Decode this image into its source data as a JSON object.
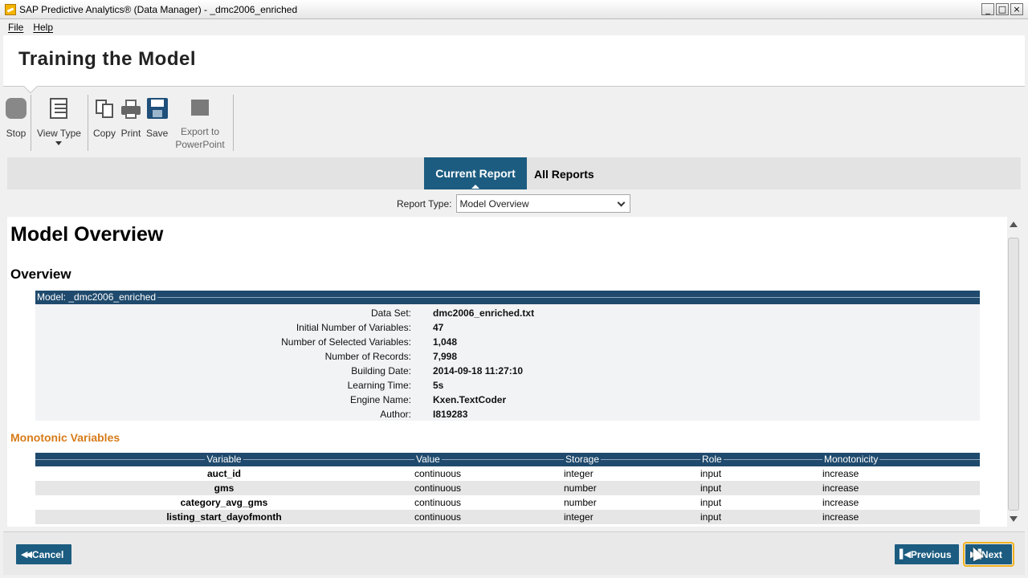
{
  "window": {
    "title": "SAP Predictive Analytics® (Data Manager) - _dmc2006_enriched",
    "controls": [
      "_",
      "□",
      "×"
    ]
  },
  "menu": {
    "items": [
      "File",
      "Help"
    ]
  },
  "header": {
    "title": "Training the Model"
  },
  "toolbar": {
    "stop": "Stop",
    "view_type": "View Type",
    "copy": "Copy",
    "print": "Print",
    "save": "Save",
    "export_line1": "Export to",
    "export_line2": "PowerPoint"
  },
  "tabs": {
    "current": "Current Report",
    "all": "All Reports"
  },
  "report_type": {
    "label": "Report Type:",
    "value": "Model Overview"
  },
  "report": {
    "title": "Model Overview",
    "overview_heading": "Overview",
    "model_band": "Model: _dmc2006_enriched",
    "info": [
      {
        "key": "Data Set:",
        "value": "dmc2006_enriched.txt"
      },
      {
        "key": "Initial Number of Variables:",
        "value": "47"
      },
      {
        "key": "Number of Selected Variables:",
        "value": "1,048"
      },
      {
        "key": "Number of Records:",
        "value": "7,998"
      },
      {
        "key": "Building Date:",
        "value": "2014-09-18 11:27:10"
      },
      {
        "key": "Learning Time:",
        "value": "5s"
      },
      {
        "key": "Engine Name:",
        "value": "Kxen.TextCoder"
      },
      {
        "key": "Author:",
        "value": "I819283"
      }
    ],
    "monotonic_heading": "Monotonic Variables",
    "columns": [
      "Variable",
      "Value",
      "Storage",
      "Role",
      "Monotonicity"
    ],
    "rows": [
      [
        "auct_id",
        "continuous",
        "integer",
        "input",
        "increase"
      ],
      [
        "gms",
        "continuous",
        "number",
        "input",
        "increase"
      ],
      [
        "category_avg_gms",
        "continuous",
        "number",
        "input",
        "increase"
      ],
      [
        "listing_start_dayofmonth",
        "continuous",
        "integer",
        "input",
        "increase"
      ]
    ]
  },
  "footer": {
    "cancel": "Cancel",
    "previous": "Previous",
    "next": "Next"
  },
  "colors": {
    "accent": "#1c5c80",
    "band": "#1f4a6d",
    "orange": "#d67b1a",
    "highlight": "#f1b11e"
  }
}
